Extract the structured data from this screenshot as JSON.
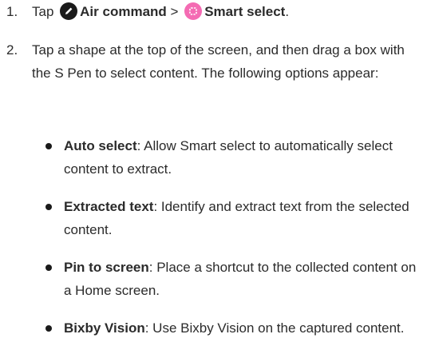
{
  "steps": [
    {
      "number": "1.",
      "prefix": "Tap",
      "air_command_icon": "pen-icon",
      "air_command_label": "Air command",
      "separator": ">",
      "smart_select_icon": "smart-select-icon",
      "smart_select_label": "Smart select",
      "suffix": "."
    },
    {
      "number": "2.",
      "text": "Tap a shape at the top of the screen, and then drag a box with the S Pen to select content. The following options appear:"
    }
  ],
  "options": [
    {
      "title": "Auto select",
      "description": ": Allow Smart select to automatically select content to extract."
    },
    {
      "title": "Extracted text",
      "description": ": Identify and extract text from the selected content."
    },
    {
      "title": "Pin to screen",
      "description": ": Place a shortcut to the collected content on a Home screen."
    },
    {
      "title": "Bixby Vision",
      "description": ": Use Bixby Vision on the captured content."
    }
  ],
  "colors": {
    "text": "#2b2b2b",
    "air_command_icon_bg": "#1a1a1a",
    "smart_select_icon_bg": "#f46bb3"
  }
}
